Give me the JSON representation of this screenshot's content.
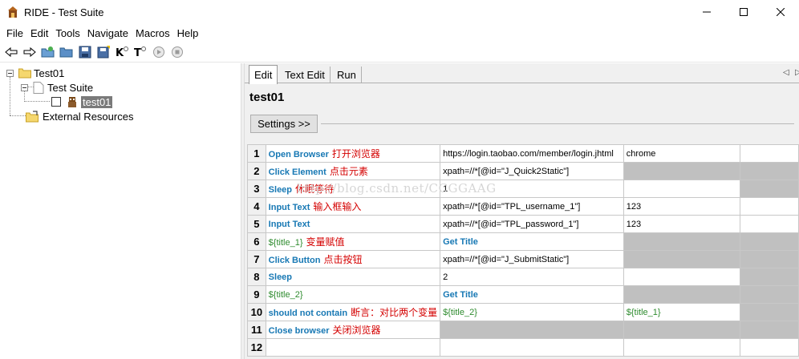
{
  "window": {
    "title": "RIDE - Test Suite",
    "minimize_icon": "minimize-icon",
    "maximize_icon": "maximize-icon",
    "close_icon": "close-icon"
  },
  "menu": [
    "File",
    "Edit",
    "Tools",
    "Navigate",
    "Macros",
    "Help"
  ],
  "toolbar_icons": [
    "back-arrow-icon",
    "forward-arrow-icon",
    "open-suite-icon",
    "open-directory-icon",
    "save-icon",
    "save-all-icon",
    "search-keywords-icon",
    "search-tests-icon",
    "run-icon",
    "stop-icon"
  ],
  "tree": {
    "project": "Test01",
    "suite": "Test Suite",
    "test": "test01",
    "external": "External Resources"
  },
  "tabs": [
    "Edit",
    "Text Edit",
    "Run"
  ],
  "editor": {
    "name": "test01",
    "settings_label": "Settings >>"
  },
  "watermark": "http://blog.csdn.net/CCGGAAG",
  "rows": [
    {
      "num": "1",
      "c1": "Open Browser",
      "note": "打开浏览器",
      "c2": "https://login.taobao.com/member/login.jhtml",
      "c3": "chrome"
    },
    {
      "num": "2",
      "c1": "Click Element",
      "note": "点击元素",
      "c2": "xpath=//*[@id=\"J_Quick2Static\"]",
      "c3": ""
    },
    {
      "num": "3",
      "c1": "Sleep",
      "note": "休眠等待",
      "c2": "1",
      "c3": ""
    },
    {
      "num": "4",
      "c1": "Input Text",
      "note": "输入框输入",
      "c2": "xpath=//*[@id=\"TPL_username_1\"]",
      "c3": "123"
    },
    {
      "num": "5",
      "c1": "Input Text",
      "note": "",
      "c2": "xpath=//*[@id=\"TPL_password_1\"]",
      "c3": "123"
    },
    {
      "num": "6",
      "c1": "${title_1}",
      "note": "变量赋值",
      "c2": "Get Title",
      "c3": ""
    },
    {
      "num": "7",
      "c1": "Click Button",
      "note": "点击按钮",
      "c2": "xpath=//*[@id=\"J_SubmitStatic\"]",
      "c3": ""
    },
    {
      "num": "8",
      "c1": "Sleep",
      "note": "",
      "c2": "2",
      "c3": ""
    },
    {
      "num": "9",
      "c1": "${title_2}",
      "note": "",
      "c2": "Get Title",
      "c3": ""
    },
    {
      "num": "10",
      "c1": "should not contain",
      "note": "断言：对比两个变量",
      "c2": "${title_2}",
      "c3": "${title_1}"
    },
    {
      "num": "11",
      "c1": "Close browser",
      "note": "关闭浏览器",
      "c2": "",
      "c3": ""
    },
    {
      "num": "12",
      "c1": "",
      "note": "",
      "c2": "",
      "c3": ""
    }
  ],
  "colors": {
    "keyword": "#1778b4",
    "variable": "#2e8b2e",
    "note": "#d40000",
    "grayed_cell": "#c0c0c0"
  }
}
